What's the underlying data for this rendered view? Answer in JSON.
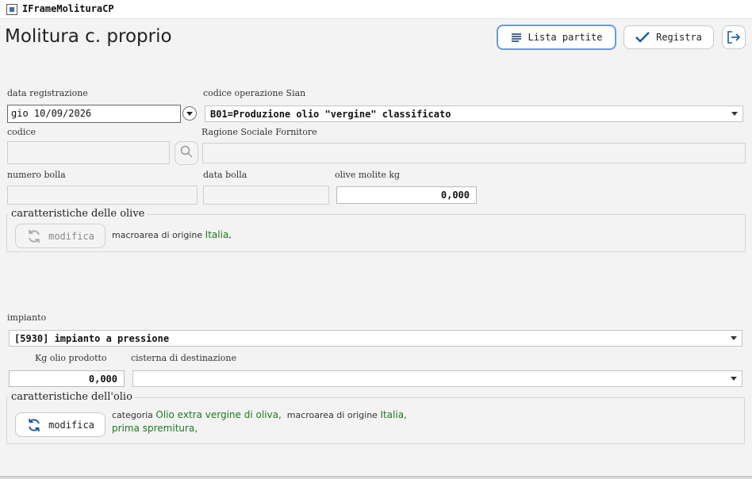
{
  "window": {
    "title": "IFrameMolituraCP"
  },
  "page": {
    "title": "Molitura c. proprio"
  },
  "toolbar": {
    "lista_partite_label": "Lista partite",
    "registra_label": "Registra"
  },
  "form": {
    "data_registrazione": {
      "label": "data registrazione",
      "value": "gio 10/09/2026"
    },
    "codice_operazione": {
      "label": "codice operazione Sian",
      "value": "B01=Produzione olio \"vergine\" classificato"
    },
    "codice": {
      "label": "codice",
      "value": ""
    },
    "ragione_sociale": {
      "label": "Ragione Sociale Fornitore",
      "value": ""
    },
    "numero_bolla": {
      "label": "numero bolla",
      "value": ""
    },
    "data_bolla": {
      "label": "data bolla",
      "value": ""
    },
    "olive_molite": {
      "label": "olive molite kg",
      "value": "0,000"
    }
  },
  "olive_group": {
    "title": "caratteristiche delle olive",
    "modifica_label": "modifica",
    "macroarea_prefix": "macroarea di origine",
    "macroarea_value": "Italia",
    "trailing": ","
  },
  "impianto": {
    "label": "impianto",
    "value": "[5930] impianto a pressione"
  },
  "kg_olio": {
    "label": "Kg olio prodotto",
    "value": "0,000"
  },
  "cisterna": {
    "label": "cisterna di destinazione",
    "value": ""
  },
  "olio_group": {
    "title": "caratteristiche dell'olio",
    "modifica_label": "modifica",
    "categoria_prefix": "categoria",
    "categoria_value": "Olio extra vergine di oliva,",
    "macroarea_prefix": "macroarea di origine",
    "macroarea_value": "Italia,",
    "spremitura_value": "prima spremitura,"
  },
  "colors": {
    "accent_border": "#6b9bd6",
    "icon_blue": "#1a5aa8",
    "value_green": "#1f7a1f"
  }
}
